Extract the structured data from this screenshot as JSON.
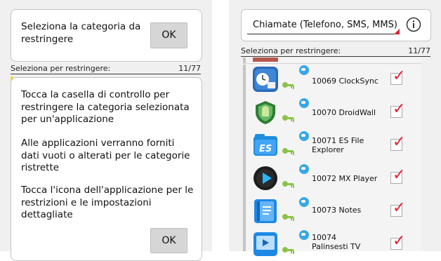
{
  "left": {
    "dialog1": {
      "text": "Seleziona la categoria da restringere",
      "ok_label": "OK"
    },
    "filter_label": "Seleziona per restringere:",
    "filter_count": "11/77",
    "dialog2": {
      "para1": "Tocca la casella di controllo per restringere la categoria selezionata per un'applicazione",
      "para2": "Alle applicazioni verranno forniti dati vuoti o alterati per le categorie ristrette",
      "para3": "Tocca l'icona dell'applicazione per le restrizioni e le impostazioni dettagliate",
      "ok_label": "OK"
    }
  },
  "right": {
    "category_spinner": {
      "selected": "Chiamate (Telefono, SMS, MMS)"
    },
    "info_icon": "info-icon",
    "filter_label": "Seleziona per restringere:",
    "filter_count": "11/77",
    "apps": [
      {
        "name": "10069 ClockSync",
        "icon": "clock-sync-icon",
        "checked": true
      },
      {
        "name": "10070 DroidWall",
        "icon": "droidwall-icon",
        "checked": true
      },
      {
        "name": "10071 ES File Explorer",
        "icon": "es-file-explorer-icon",
        "checked": true
      },
      {
        "name": "10072 MX Player",
        "icon": "mx-player-icon",
        "checked": true
      },
      {
        "name": "10073 Notes",
        "icon": "notes-icon",
        "checked": true
      },
      {
        "name": "10074 Palinsesti TV",
        "icon": "palinsesti-tv-icon",
        "checked": true
      }
    ],
    "colors": {
      "check": "#e0212e",
      "globe": "#39a7e6",
      "key": "#8bc34a",
      "spinner_accent": "#e0212e"
    }
  }
}
